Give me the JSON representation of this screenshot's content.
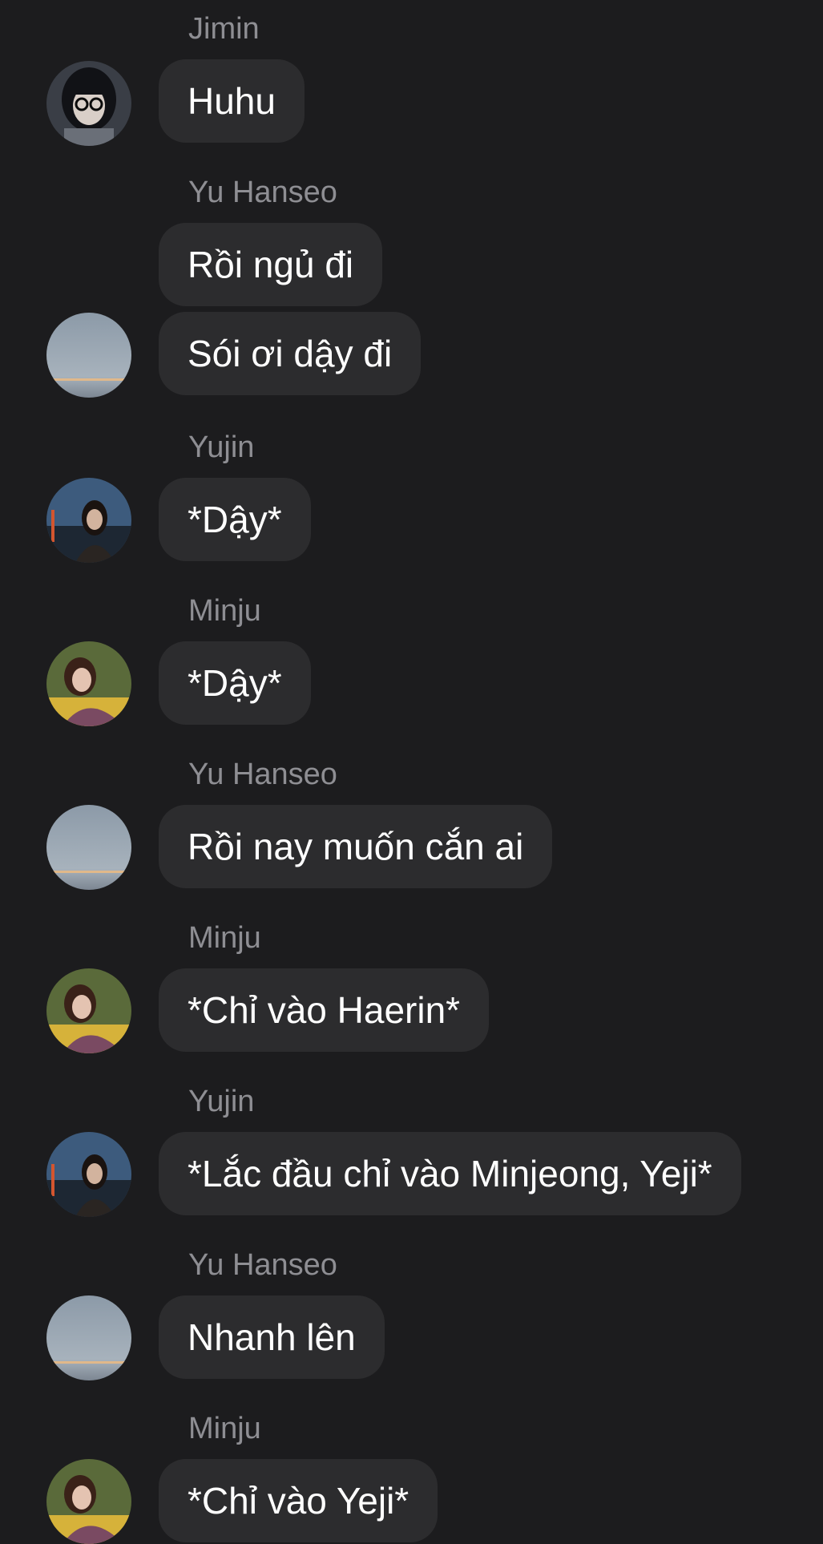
{
  "messages": [
    {
      "sender": "Jimin",
      "texts": [
        "Huhu"
      ]
    },
    {
      "sender": "Yu Hanseo",
      "texts": [
        "Rồi ngủ đi",
        "Sói ơi dậy đi"
      ]
    },
    {
      "sender": "Yujin",
      "texts": [
        "*Dậy*"
      ]
    },
    {
      "sender": "Minju",
      "texts": [
        "*Dậy*"
      ]
    },
    {
      "sender": "Yu Hanseo",
      "texts": [
        "Rồi nay muốn cắn ai"
      ]
    },
    {
      "sender": "Minju",
      "texts": [
        "*Chỉ vào Haerin*"
      ]
    },
    {
      "sender": "Yujin",
      "texts": [
        "*Lắc đầu chỉ vào Minjeong, Yeji*"
      ]
    },
    {
      "sender": "Yu Hanseo",
      "texts": [
        "Nhanh lên"
      ]
    },
    {
      "sender": "Minju",
      "texts": [
        "*Chỉ vào Yeji*"
      ]
    }
  ],
  "colors": {
    "background": "#1c1c1e",
    "bubble": "#2c2c2e",
    "sender_text": "#8e8e93",
    "message_text": "#ffffff"
  }
}
